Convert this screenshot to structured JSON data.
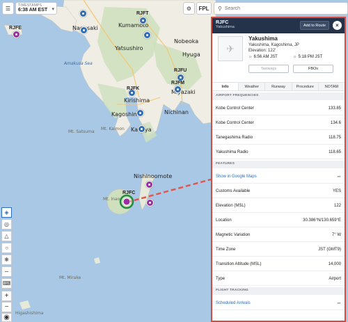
{
  "toolbar": {
    "timestamps_caption": "TIMESTAMPS",
    "timestamp_value": "6:38 AM EST",
    "fpl_label": "FPL",
    "search_placeholder": "Search"
  },
  "map": {
    "labels": [
      {
        "name": "Nagasaki",
        "kind": "city"
      },
      {
        "name": "Kumamoto",
        "kind": "city"
      },
      {
        "name": "Yatsushiro",
        "kind": "city"
      },
      {
        "name": "Nobeoka",
        "kind": "city"
      },
      {
        "name": "Hyuga",
        "kind": "city"
      },
      {
        "name": "Kirishima",
        "kind": "city"
      },
      {
        "name": "Miyazaki",
        "kind": "city"
      },
      {
        "name": "Kagoshima",
        "kind": "city"
      },
      {
        "name": "Nichinan",
        "kind": "city"
      },
      {
        "name": "Kanoya",
        "kind": "city"
      },
      {
        "name": "Nishinoomote",
        "kind": "city"
      },
      {
        "name": "Amakusa Sea",
        "kind": "sea"
      },
      {
        "name": "Mt. Satsuma",
        "kind": "mt"
      },
      {
        "name": "Mt. Kaimon",
        "kind": "mt"
      },
      {
        "name": "Mt. Inao",
        "kind": "mt"
      },
      {
        "name": "Mt. Mirake",
        "kind": "mt"
      },
      {
        "name": "Higashishima",
        "kind": "mt"
      }
    ],
    "airports": [
      "RJFE",
      "RJFT",
      "RJFU",
      "RJFK",
      "RJFM",
      "RJFC"
    ]
  },
  "panel": {
    "code": "RJFC",
    "subtitle": "Yakushima",
    "add_to_route": "Add to Route",
    "name": "Yakushima",
    "location": "Yakushima, Kagoshima, JP",
    "elevation": "Elevation: 122'",
    "sunrise": "6:56 AM JST",
    "sunset": "5:18 PM JST",
    "taxiways": "Taxiways",
    "fbos": "FBOs",
    "tabs": [
      "Info",
      "Weather",
      "Runway",
      "Procedure",
      "NOTAM"
    ],
    "freq_header": "AIRPORT FREQUENCIES",
    "frequencies": [
      {
        "name": "Kobe Control Center",
        "value": "133.85"
      },
      {
        "name": "Kobe Control Center",
        "value": "134.6"
      },
      {
        "name": "Tanegashima Radio",
        "value": "118.75"
      },
      {
        "name": "Yakushima Radio",
        "value": "118.65"
      }
    ],
    "features_header": "FEATURES",
    "google_maps": "Show in Google Maps",
    "features": [
      {
        "name": "Customs Available",
        "value": "YES"
      },
      {
        "name": "Elevation (MSL)",
        "value": "122"
      },
      {
        "name": "Location",
        "value": "30.386°N/130.659°E"
      },
      {
        "name": "Magnetic Variation",
        "value": "7° W"
      },
      {
        "name": "Time Zone",
        "value": "JST (GMT9)"
      },
      {
        "name": "Transition Altitude (MSL)",
        "value": "14,000"
      },
      {
        "name": "Type",
        "value": "Airport"
      }
    ],
    "tracking_header": "FLIGHT TRACKING",
    "scheduled_arrivals": "Scheduled Arrivals"
  }
}
